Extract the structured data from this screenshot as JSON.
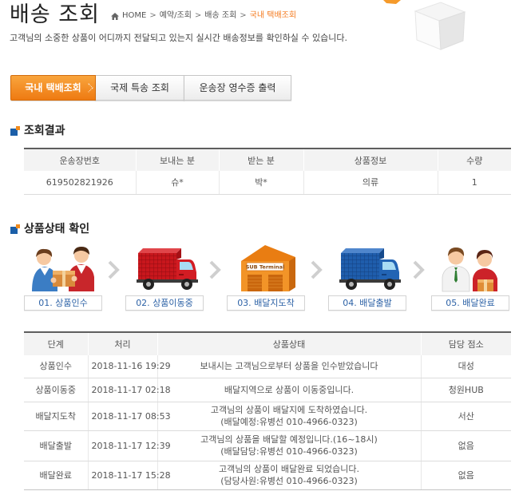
{
  "page": {
    "title": "배송 조회",
    "subtitle": "고객님의 소중한 상품이 어디까지 전달되고 있는지 실시간 배송정보를 확인하실 수 있습니다."
  },
  "breadcrumb": {
    "home_icon": "home-icon",
    "items": [
      "HOME",
      "예약/조회",
      "배송 조회",
      "국내 택배조회"
    ],
    "separator": ">"
  },
  "tabs": [
    {
      "label": "국내 택배조회",
      "active": true
    },
    {
      "label": "국제 특송 조회",
      "active": false
    },
    {
      "label": "운송장 영수증 출력",
      "active": false
    }
  ],
  "results": {
    "heading": "조회결과",
    "columns": [
      "운송장번호",
      "보내는 분",
      "받는 분",
      "상품정보",
      "수량"
    ],
    "rows": [
      {
        "waybill": "619502821926",
        "sender": "슈*",
        "receiver": "박*",
        "product": "의류",
        "quantity": "1"
      }
    ]
  },
  "status": {
    "heading": "상품상태 확인",
    "arrow_icon": "chevron-right-icon",
    "steps": [
      {
        "number": "01.",
        "label": "상품인수",
        "icon": "handover-illustration"
      },
      {
        "number": "02.",
        "label": "상품이동중",
        "icon": "red-truck-illustration"
      },
      {
        "number": "03.",
        "label": "배달지도착",
        "icon": "sub-terminal-illustration",
        "sign_text": "SUB Terminal"
      },
      {
        "number": "04.",
        "label": "배달출발",
        "icon": "blue-truck-illustration"
      },
      {
        "number": "05.",
        "label": "배달완료",
        "icon": "delivered-illustration"
      }
    ]
  },
  "tracking": {
    "columns": [
      "단계",
      "처리",
      "상품상태",
      "담당 점소"
    ],
    "rows": [
      {
        "step": "상품인수",
        "time": "2018-11-16 19:29",
        "status": [
          "보내시는 고객님으로부터 상품을 인수받았습니다"
        ],
        "branch": "대성"
      },
      {
        "step": "상품이동중",
        "time": "2018-11-17 02:18",
        "status": [
          "배달지역으로 상품이 이동중입니다."
        ],
        "branch": "청원HUB"
      },
      {
        "step": "배달지도착",
        "time": "2018-11-17 08:53",
        "status": [
          "고객님의 상품이 배달지에 도착하였습니다.",
          "(배달예정:유병선 010-4966-0323)"
        ],
        "branch": "서산"
      },
      {
        "step": "배달출발",
        "time": "2018-11-17 12:39",
        "status": [
          "고객님의 상품을 배달할 예정입니다.(16~18시)",
          "(배달담당:유병선 010-4966-0323)"
        ],
        "branch": "없음"
      },
      {
        "step": "배달완료",
        "time": "2018-11-17 15:28",
        "status": [
          "고객님의 상품이 배달완료 되었습니다.",
          "(담당사원:유병선 010-4966-0323)"
        ],
        "branch": "없음"
      }
    ]
  },
  "colors": {
    "accent": "#f47b20",
    "tab_active": "#ee7a12",
    "step_label": "#2d62a6",
    "bullet_blue": "#1b5fa8",
    "bullet_orange": "#f08a1c"
  }
}
